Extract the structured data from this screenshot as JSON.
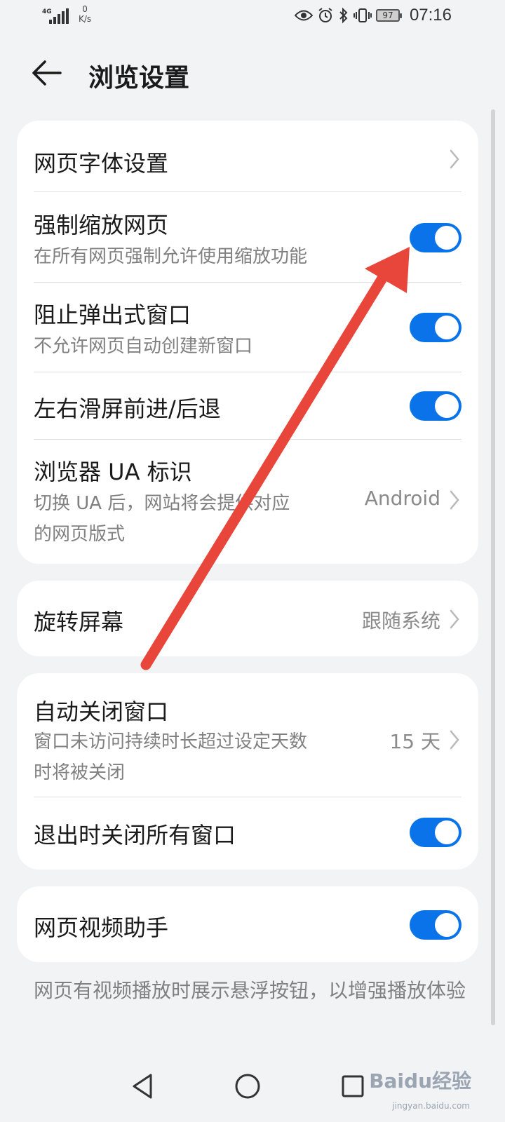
{
  "status_bar": {
    "network": "4G",
    "speed_value": "0",
    "speed_unit": "K/s",
    "battery": "97",
    "time": "07:16"
  },
  "header": {
    "title": "浏览设置"
  },
  "sections": {
    "font_settings": {
      "title": "网页字体设置"
    },
    "force_zoom": {
      "title": "强制缩放网页",
      "subtitle": "在所有网页强制允许使用缩放功能",
      "enabled": true
    },
    "block_popups": {
      "title": "阻止弹出式窗口",
      "subtitle": "不允许网页自动创建新窗口",
      "enabled": true
    },
    "swipe_nav": {
      "title": "左右滑屏前进/后退",
      "enabled": true
    },
    "ua": {
      "title": "浏览器 UA 标识",
      "subtitle": "切换 UA 后，网站将会提供对应的网页版式",
      "value": "Android"
    },
    "rotate": {
      "title": "旋转屏幕",
      "value": "跟随系统"
    },
    "auto_close": {
      "title": "自动关闭窗口",
      "subtitle": "窗口未访问持续时长超过设定天数时将被关闭",
      "value": "15 天"
    },
    "close_on_exit": {
      "title": "退出时关闭所有窗口",
      "enabled": true
    },
    "video_helper": {
      "title": "网页视频助手",
      "enabled": true
    }
  },
  "footer_note": "网页有视频播放时展示悬浮按钮，以增强播放体验",
  "colors": {
    "background": "#f1f3f5",
    "toggle_on": "#0a73ea",
    "annotation_arrow": "#e8463a"
  },
  "watermark": {
    "brand": "Baidu经验",
    "url": "jingyan.baidu.com"
  }
}
